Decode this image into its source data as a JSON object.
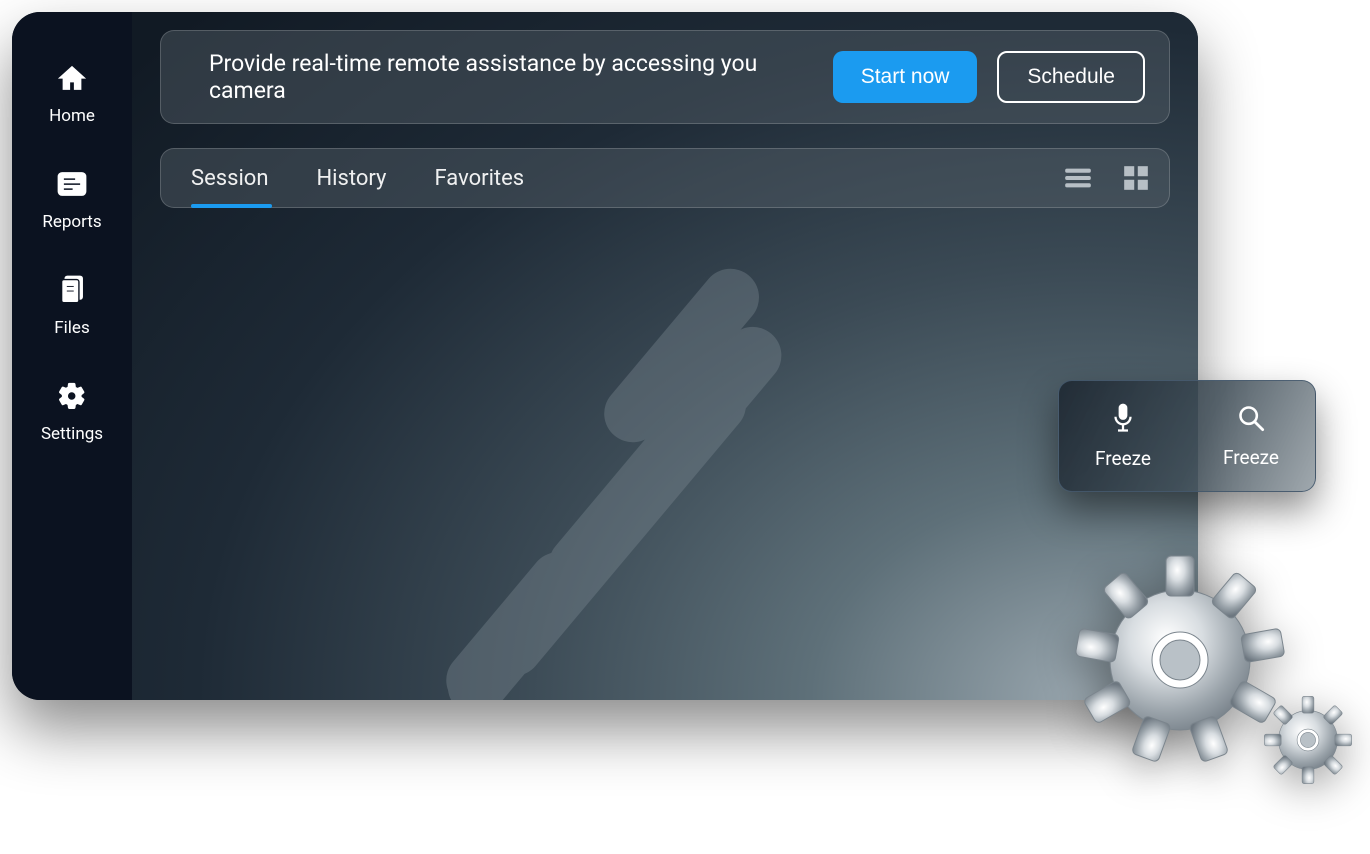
{
  "sidebar": {
    "items": [
      {
        "label": "Home"
      },
      {
        "label": "Reports"
      },
      {
        "label": "Files"
      },
      {
        "label": "Settings"
      }
    ]
  },
  "banner": {
    "text": "Provide real-time remote assistance by accessing you camera",
    "primary_label": "Start now",
    "secondary_label": "Schedule"
  },
  "tabs": {
    "items": [
      {
        "label": "Session"
      },
      {
        "label": "History"
      },
      {
        "label": "Favorites"
      }
    ],
    "active_index": 0
  },
  "floating_panel": {
    "items": [
      {
        "label": "Freeze",
        "icon": "mic"
      },
      {
        "label": "Freeze",
        "icon": "search"
      }
    ]
  },
  "colors": {
    "accent": "#1b9bf0"
  }
}
